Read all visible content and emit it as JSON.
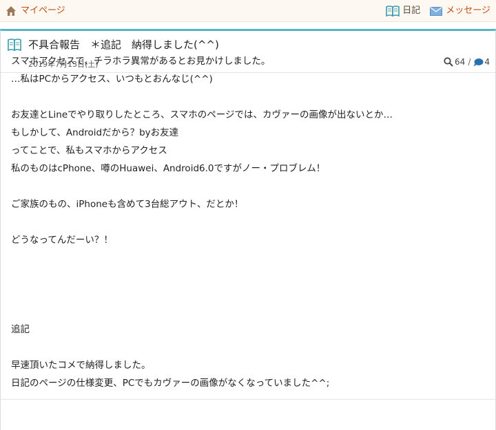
{
  "topbar": {
    "mypage_label": "マイページ",
    "diary_label": "日記",
    "message_label": "メッセージ"
  },
  "entry": {
    "title": "不具合報告　＊追記　納得しました(^^)",
    "date": "2019年7月13日(土)",
    "views": "64",
    "comments": "4",
    "separator": "/"
  },
  "body_lines": [
    "スマホアクセスで、チラホラ異常があるとお見かけしました。",
    "…私はPCからアクセス、いつもとおんなじ(^^)",
    "",
    "お友達とLineでやり取りしたところ、スマホのページでは、カヴァーの画像が出ないとか…",
    "もしかして、Androidだから？byお友達",
    "ってことで、私もスマホからアクセス",
    "私のものはcPhone、噂のHuawei、Android6.0ですがノー・プロブレム！",
    "",
    "ご家族のもの、iPhoneも含めて3台総アウト、だとか！",
    "",
    "どうなってんだーい？！",
    "",
    "",
    "",
    "",
    "追記",
    "",
    "早速頂いたコメで納得しました。",
    "日記のページの仕様変更、PCでもカヴァーの画像がなくなっていました^^;"
  ],
  "colors": {
    "accent": "#5ab4c4",
    "link": "#c04e10",
    "comment_icon": "#2a6fb0"
  }
}
